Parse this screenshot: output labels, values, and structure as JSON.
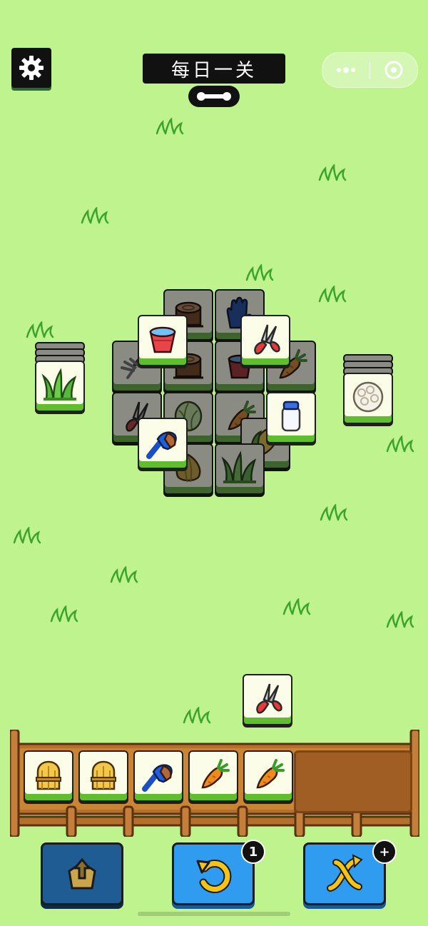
{
  "header": {
    "title": "每日一关",
    "settings_icon": "gear-icon",
    "progress_icon": "bone-progress-icon",
    "menu_more_icon": "more-dots-icon",
    "menu_close_icon": "target-close-icon"
  },
  "board": {
    "left_stack_top": "grass",
    "right_stack_top": "cauliflower",
    "layers": {
      "bottom": [
        "stump",
        "gloves",
        "rake",
        "stump",
        "watering-pot",
        "carrot",
        "shears",
        "cabbage",
        "carrot",
        "corn",
        "onion",
        "grass"
      ],
      "top": [
        "bucket",
        "shears",
        "brush",
        "milk-jar"
      ]
    },
    "floating_tile": "shears"
  },
  "tray": {
    "capacity": 7,
    "slots": [
      "wheat",
      "wheat",
      "brush",
      "carrot",
      "carrot"
    ]
  },
  "tools": {
    "remove": {
      "icon": "pop-out-icon",
      "badge": ""
    },
    "undo": {
      "icon": "undo-icon",
      "badge": "1"
    },
    "shuffle": {
      "icon": "shuffle-icon",
      "badge": "+"
    }
  },
  "colors": {
    "background": "#bff38e",
    "tile_face": "#fbfde8",
    "tile_base": "#5fbd2e",
    "button_blue": "#2f9cf0",
    "button_dark": "#1f5c93"
  }
}
